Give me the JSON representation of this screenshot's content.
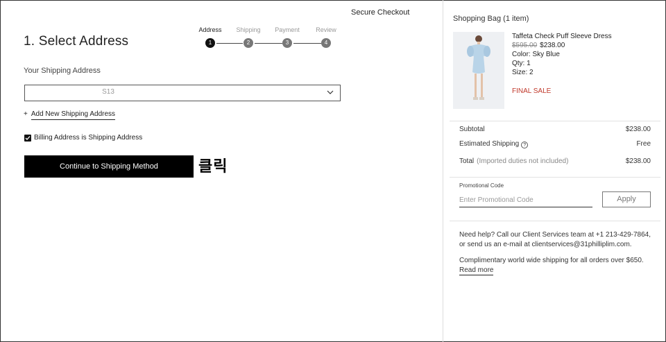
{
  "header": {
    "secure_checkout": "Secure Checkout"
  },
  "steps": {
    "title": "1. Select Address",
    "items": [
      {
        "label": "Address",
        "number": "1"
      },
      {
        "label": "Shipping",
        "number": "2"
      },
      {
        "label": "Payment",
        "number": "3"
      },
      {
        "label": "Review",
        "number": "4"
      }
    ]
  },
  "address": {
    "label": "Your Shipping Address",
    "selected": "S13",
    "add_new": "Add New Shipping Address",
    "add_prefix": "+",
    "billing_same": "Billing Address is Shipping Address",
    "continue_button": "Continue to Shipping Method"
  },
  "annotation": "클릭",
  "bag": {
    "title": "Shopping Bag (1 item)",
    "product": {
      "name": "Taffeta Check Puff Sleeve Dress",
      "price_old": "$595.00",
      "price_new": "$238.00",
      "color": "Color: Sky Blue",
      "qty": "Qty: 1",
      "size": "Size: 2",
      "final_sale": "FINAL SALE"
    },
    "summary": {
      "subtotal_label": "Subtotal",
      "subtotal_value": "$238.00",
      "shipping_label": "Estimated Shipping",
      "shipping_value": "Free",
      "total_label": "Total",
      "total_note": "(Imported duties not included)",
      "total_value": "$238.00"
    },
    "promo": {
      "label": "Promotional Code",
      "placeholder": "Enter Promotional Code",
      "apply": "Apply"
    },
    "help": "Need help? Call our Client Services team at +1 213-429-7864, or send us an e-mail at clientservices@31philliplim.com.",
    "shipping_note": "Complimentary world wide shipping for all orders over $650.",
    "read_more": "Read more"
  },
  "colors": {
    "final_sale": "#c0392b",
    "primary_button": "#000000"
  }
}
